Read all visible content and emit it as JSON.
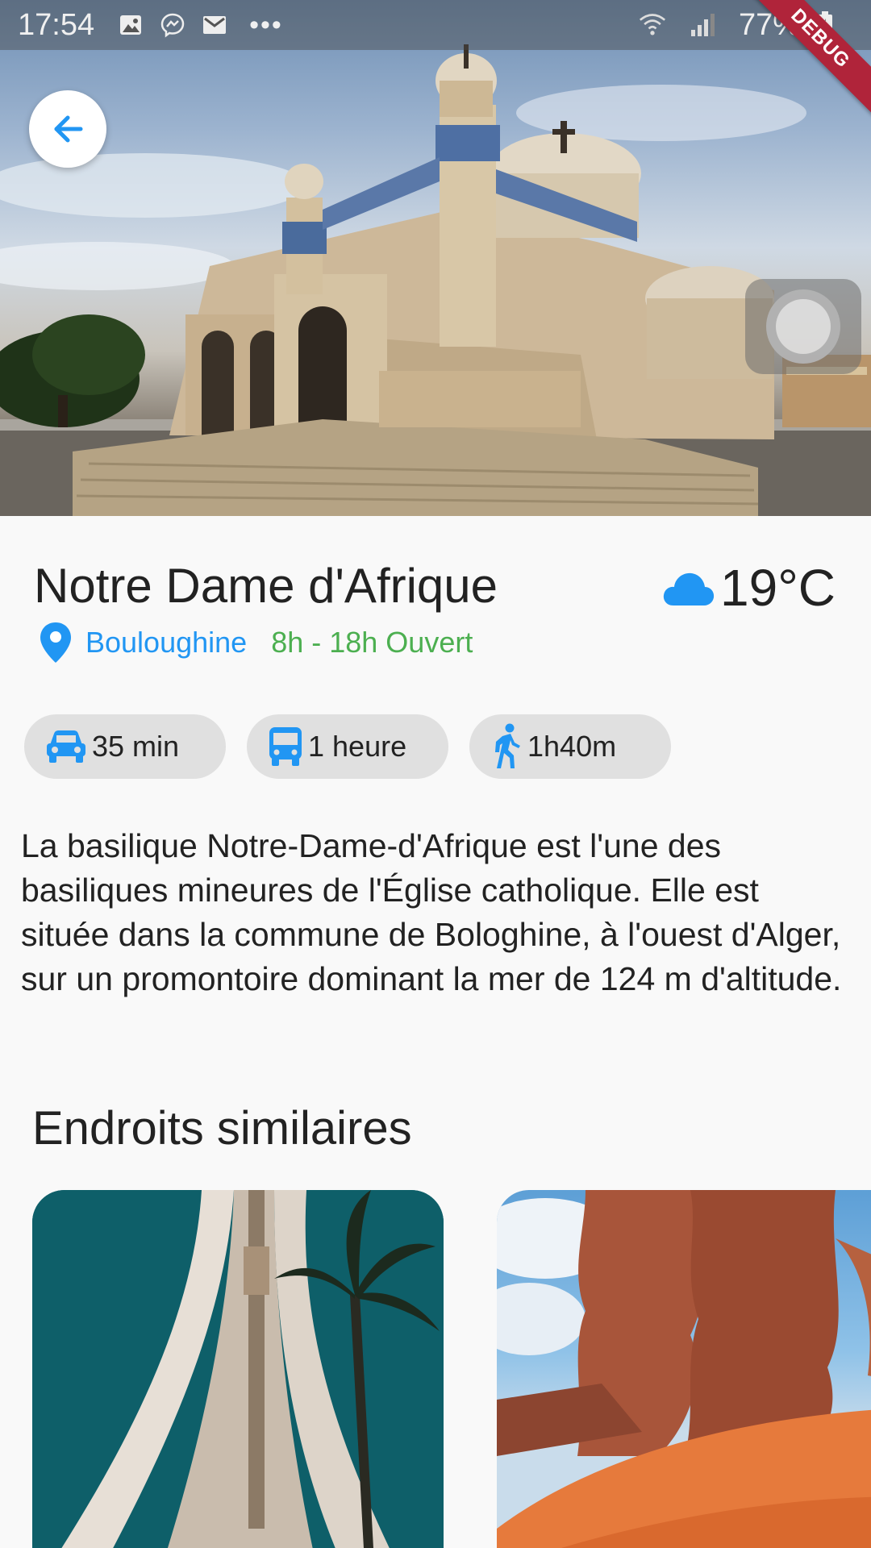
{
  "status_bar": {
    "time": "17:54",
    "left_icons": [
      "gallery-icon",
      "messenger-icon",
      "gmail-icon"
    ],
    "more": "•••",
    "battery_percent": "77%",
    "right_icons": [
      "wifi-icon",
      "signal-icon",
      "battery-charging-icon"
    ]
  },
  "debug_banner": "DEBUG",
  "place": {
    "name": "Notre Dame d'Afrique",
    "location": "Bouloughine",
    "hours": "8h - 18h Ouvert",
    "weather": {
      "icon": "cloud-icon",
      "temperature": "19°C"
    }
  },
  "travel_times": [
    {
      "icon": "car-icon",
      "label": "35 min"
    },
    {
      "icon": "bus-icon",
      "label": "1 heure"
    },
    {
      "icon": "walk-icon",
      "label": "1h40m"
    }
  ],
  "description": "La basilique Notre-Dame-d'Afrique est l'une des basiliques mineures de l'Église catholique. Elle est située dans la commune de Bologhine, à l'ouest d'Alger, sur un promontoire dominant la mer de 124 m d'altitude.",
  "similar": {
    "title": "Endroits similaires"
  },
  "colors": {
    "accent_blue": "#2196f3",
    "open_green": "#4caf50",
    "chip_bg": "#e0e0e0",
    "debug_red": "#b0243a"
  }
}
